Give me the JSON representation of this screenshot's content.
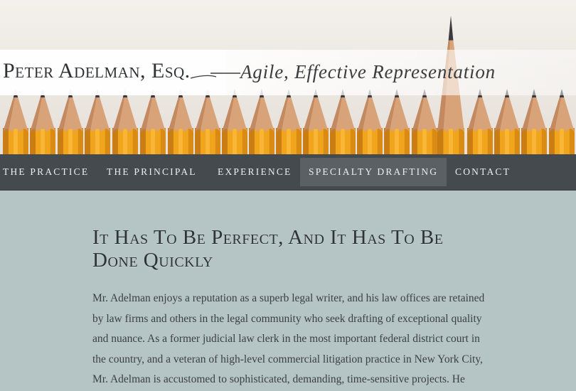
{
  "header": {
    "brand_name": "Peter Adelman, Esq.",
    "tagline": "Agile, Effective Representation"
  },
  "nav": {
    "items": [
      {
        "label": "The Practice",
        "active": false
      },
      {
        "label": "The Principal",
        "active": false
      },
      {
        "label": "Experience",
        "active": false
      },
      {
        "label": "Specialty Drafting",
        "active": true
      },
      {
        "label": "Contact",
        "active": false
      }
    ]
  },
  "main": {
    "title_line1": "It Has To Be Perfect, And It Has To Be",
    "title_line2": "Done Quickly",
    "paragraph_lines": [
      "Mr. Adelman enjoys a reputation as a superb legal writer, and his law offices are retained",
      "by law firms and others in the legal community who seek drafting of exceptional quality",
      "and nuance. As a former judicial law clerk in the most important federal district court in",
      "the country, and a veteran of high-level commercial litigation practice in New York City,",
      "Mr. Adelman is accustomed to sophisticated, demanding, time-sensitive projects. He"
    ]
  },
  "colors": {
    "nav_background": "#454a4e",
    "nav_active": "#5b6064",
    "page_background": "#b5c5c6",
    "pencil_orange": "#f0a51c"
  }
}
